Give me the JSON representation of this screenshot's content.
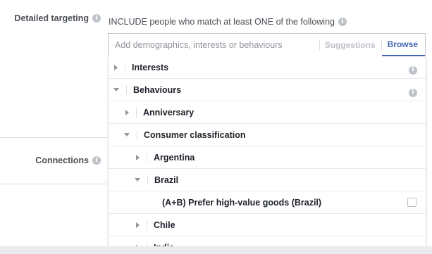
{
  "detailed_targeting": {
    "label": "Detailed targeting",
    "include_text": "INCLUDE people who match at least ONE of the following",
    "search_placeholder": "Add demographics, interests or behaviours",
    "suggestions_label": "Suggestions",
    "browse_label": "Browse"
  },
  "connections": {
    "label": "Connections"
  },
  "tree": {
    "interests": "Interests",
    "behaviours": "Behaviours",
    "anniversary": "Anniversary",
    "consumer_classification": "Consumer classification",
    "argentina": "Argentina",
    "brazil": "Brazil",
    "brazil_option": "(A+B) Prefer high-value goods (Brazil)",
    "chile": "Chile",
    "india": "India"
  },
  "icons": {
    "info": "i"
  },
  "colors": {
    "accent": "#4267b2",
    "muted": "#bec2c9",
    "label": "#4b4f56"
  }
}
